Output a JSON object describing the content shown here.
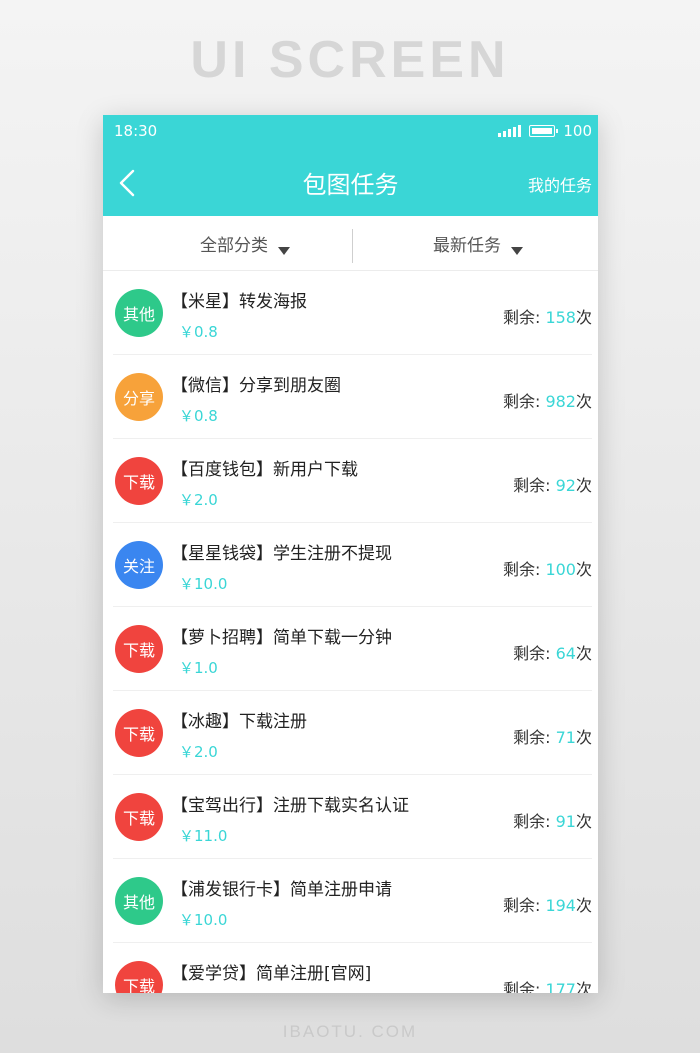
{
  "banner": {
    "title": "UI SCREEN",
    "footer": "IBAOTU. COM"
  },
  "colors": {
    "accent": "#3ad6d6",
    "other": "#2ec98a",
    "share": "#f7a23a",
    "download": "#f0443e",
    "follow": "#3a86f0"
  },
  "status_bar": {
    "time": "18:30",
    "battery": "100"
  },
  "header": {
    "back_icon": "chevron-left-icon",
    "title": "包图任务",
    "my_tasks": "我的任务"
  },
  "filters": {
    "category": "全部分类",
    "sort": "最新任务"
  },
  "tasks": [
    {
      "badge": "其他",
      "badge_color": "#2ec98a",
      "title": "【米星】转发海报",
      "price": "￥0.8",
      "remain_label": "剩余: ",
      "remain_count": "158",
      "remain_unit": "次"
    },
    {
      "badge": "分享",
      "badge_color": "#f7a23a",
      "title": "【微信】分享到朋友圈",
      "price": "￥0.8",
      "remain_label": "剩余: ",
      "remain_count": "982",
      "remain_unit": "次"
    },
    {
      "badge": "下载",
      "badge_color": "#f0443e",
      "title": "【百度钱包】新用户下载",
      "price": "￥2.0",
      "remain_label": "剩余: ",
      "remain_count": "92",
      "remain_unit": "次"
    },
    {
      "badge": "关注",
      "badge_color": "#3a86f0",
      "title": "【星星钱袋】学生注册不提现",
      "price": "￥10.0",
      "remain_label": "剩余: ",
      "remain_count": "100",
      "remain_unit": "次"
    },
    {
      "badge": "下载",
      "badge_color": "#f0443e",
      "title": "【萝卜招聘】简单下载一分钟",
      "price": "￥1.0",
      "remain_label": "剩余: ",
      "remain_count": "64",
      "remain_unit": "次"
    },
    {
      "badge": "下载",
      "badge_color": "#f0443e",
      "title": "【冰趣】下载注册",
      "price": "￥2.0",
      "remain_label": "剩余: ",
      "remain_count": "71",
      "remain_unit": "次"
    },
    {
      "badge": "下载",
      "badge_color": "#f0443e",
      "title": "【宝驾出行】注册下载实名认证",
      "price": "￥11.0",
      "remain_label": "剩余: ",
      "remain_count": "91",
      "remain_unit": "次"
    },
    {
      "badge": "其他",
      "badge_color": "#2ec98a",
      "title": "【浦发银行卡】简单注册申请",
      "price": "￥10.0",
      "remain_label": "剩余: ",
      "remain_count": "194",
      "remain_unit": "次"
    },
    {
      "badge": "下载",
      "badge_color": "#f0443e",
      "title": "【爱学贷】简单注册[官网]",
      "price": "",
      "remain_label": "剩余: ",
      "remain_count": "177",
      "remain_unit": "次"
    }
  ]
}
